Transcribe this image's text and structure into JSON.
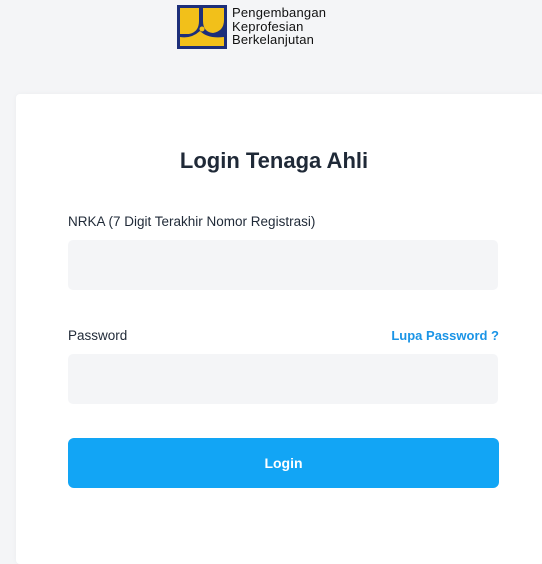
{
  "logo": {
    "lines": [
      "Pengembangan",
      "Keprofesian",
      "Berkelanjutan"
    ]
  },
  "login": {
    "title": "Login Tenaga Ahli",
    "nrka_label": "NRKA (7 Digit Terakhir Nomor Registrasi)",
    "nrka_value": "",
    "password_label": "Password",
    "password_value": "",
    "forgot_password_link": "Lupa Password ?",
    "submit_label": "Login"
  },
  "colors": {
    "accent": "#12a5f5",
    "link": "#1a94e6",
    "logo_yellow": "#f2c01a",
    "logo_navy": "#1d2f7a"
  }
}
